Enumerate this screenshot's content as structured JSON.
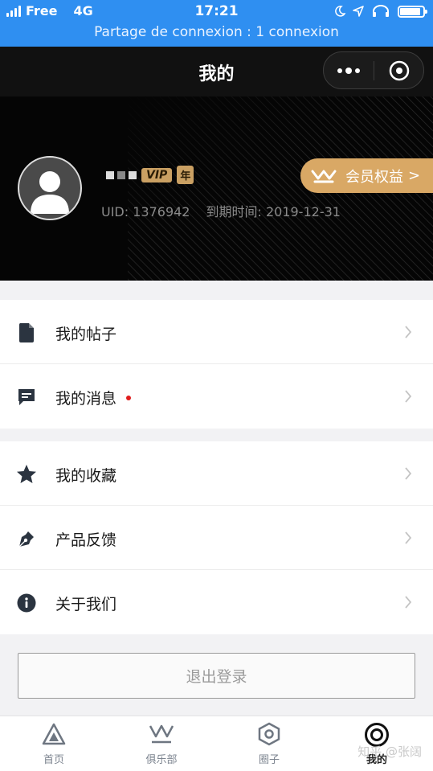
{
  "status_bar": {
    "carrier": "Free",
    "network": "4G",
    "time": "17:21",
    "hotspot_text": "Partage de connexion : 1 connexion",
    "signal_bars": 4,
    "battery_level": 0.9
  },
  "nav": {
    "title": "我的"
  },
  "profile": {
    "vip_badge": "VIP",
    "year_badge": "年",
    "uid": "UID: 1376942",
    "expiry": "到期时间: 2019-12-31",
    "member_button": "会员权益",
    "member_arrow": ">"
  },
  "menu_group_1": [
    {
      "label": "我的帖子",
      "icon": "document-icon"
    },
    {
      "label": "我的消息",
      "icon": "message-icon",
      "unread": true
    }
  ],
  "menu_group_2": [
    {
      "label": "我的收藏",
      "icon": "star-icon"
    },
    {
      "label": "产品反馈",
      "icon": "pen-icon"
    },
    {
      "label": "关于我们",
      "icon": "info-icon"
    }
  ],
  "logout": {
    "label": "退出登录"
  },
  "tabs": [
    {
      "label": "首页",
      "icon": "home-triangle-icon",
      "active": false
    },
    {
      "label": "俱乐部",
      "icon": "crown-icon",
      "active": false
    },
    {
      "label": "圈子",
      "icon": "hexagon-icon",
      "active": false
    },
    {
      "label": "我的",
      "icon": "target-icon",
      "active": true
    }
  ],
  "watermark": "知乎 @张阔",
  "colors": {
    "status_bar_bg": "#2f8ff1",
    "gold_accent": "#d9a865",
    "unread_dot": "#e01c1c"
  }
}
